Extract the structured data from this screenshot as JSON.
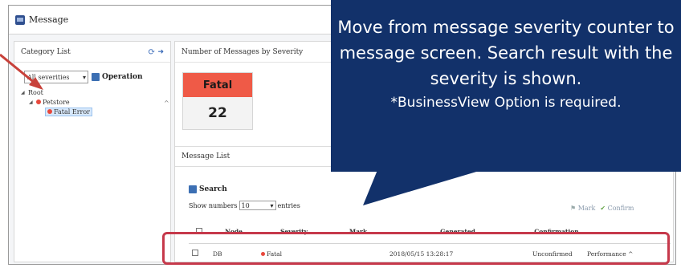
{
  "window": {
    "title": "Message"
  },
  "category_panel": {
    "title": "Category List",
    "filter_value": "All severities",
    "operation_label": "Operation",
    "tree": [
      {
        "label": "Root",
        "level": 0
      },
      {
        "label": "Petstore",
        "level": 1
      },
      {
        "label": "Fatal Error",
        "level": 2
      }
    ]
  },
  "severity_panel": {
    "title": "Number of Messages by Severity",
    "card_label": "Fatal",
    "card_count": "22"
  },
  "message_list": {
    "title": "Message List",
    "search_label": "Search",
    "show_label": "Show numbers",
    "show_value": "10",
    "entries_label": "entries",
    "mark_label": "Mark",
    "confirm_label": "Confirm",
    "columns": [
      "Node",
      "Severity",
      "Mark",
      "Generated",
      "Confirmation"
    ],
    "rows": [
      {
        "node": "DB",
        "severity": "Fatal",
        "mark": "",
        "generated": "2018/05/15 13:28:17",
        "confirmation": "Unconfirmed",
        "category": "Performance"
      }
    ]
  },
  "callout": {
    "main": "Move from message severity counter to message screen. Search result with the severity is shown.",
    "note": "*BusinessView Option is required."
  },
  "colors": {
    "callout_bg": "#12316a",
    "fatal": "#ef5a47",
    "highlight": "#c6394b"
  }
}
